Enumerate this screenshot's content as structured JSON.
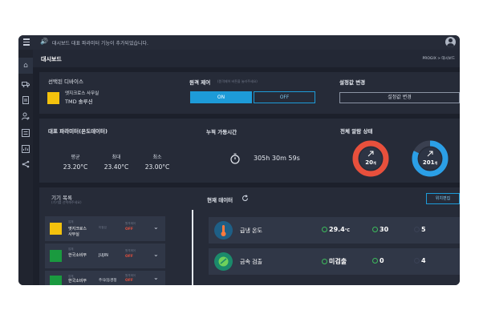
{
  "topbar": {
    "notice": "대시보드 대표 파라미터 기능이 추가되었습니다.",
    "speaker_icon": "speaker-icon",
    "user_icon": "user-icon"
  },
  "sidebar": {
    "items": [
      {
        "icon": "home-icon"
      },
      {
        "icon": "truck-icon"
      },
      {
        "icon": "document-icon"
      },
      {
        "icon": "user-settings-icon"
      },
      {
        "icon": "list-icon"
      },
      {
        "icon": "chart-icon"
      },
      {
        "icon": "share-icon"
      }
    ]
  },
  "header": {
    "title": "대시보드",
    "breadcrumb": "PROGIX > 대시보드"
  },
  "selected_device": {
    "label": "선택된 디바이스",
    "line1": "엣지크로스 사무실",
    "line2": "TMD 솔루션",
    "color": "#f4c20d"
  },
  "remote_control": {
    "label": "원격 제어",
    "hint": "(원격제어 버튼을 눌러주세요)",
    "on_label": "ON",
    "off_label": "OFF",
    "accent": "#1d9bd8"
  },
  "settings": {
    "label": "설정값 변경",
    "button": "설정값 변경"
  },
  "representative": {
    "title": "대표 파라미터(온도데이터)",
    "stats": [
      {
        "label": "평균",
        "value": "23.20°C"
      },
      {
        "label": "최대",
        "value": "23.40°C"
      },
      {
        "label": "최소",
        "value": "23.00°C"
      }
    ]
  },
  "runtime": {
    "title": "누적 가동시간",
    "value": "305h 30m 59s",
    "icon": "stopwatch-icon"
  },
  "alarm": {
    "title": "전체 알람 상태",
    "rings": [
      {
        "value": "20",
        "unit": "개",
        "color": "#e8503c",
        "fill": 1.0
      },
      {
        "value": "201",
        "unit": "개",
        "color": "#2b9fe6",
        "fill": 0.82
      }
    ]
  },
  "device_list": {
    "title": "기기 목록",
    "subtitle": "(기기를 선택해주세요)",
    "items": [
      {
        "tag": "업체",
        "name": "엣지크로스\n사무실",
        "status": "미점검",
        "off_label": "원격제어",
        "off": "OFF",
        "color": "#f4c20d"
      },
      {
        "tag": "업체",
        "name": "한국소비부",
        "status": "JUJIN",
        "off_label": "원격제어",
        "off": "OFF",
        "color": "#1a9a3f"
      },
      {
        "tag": "업체",
        "name": "한국소비부",
        "status": "주식(동경정",
        "off_label": "원격제어",
        "off": "OFF",
        "color": "#1a9a3f"
      }
    ]
  },
  "current_data": {
    "title": "현재 데이터",
    "edit_button": "위치편집",
    "rows": [
      {
        "name": "급냉 온도",
        "v1": "29.4",
        "v1_unit": "°C",
        "v2": "30",
        "v3": "5",
        "icon": "thermometer-icon",
        "icon_bg": "#1e5f86"
      },
      {
        "name": "금속 검출",
        "v1": "미검출",
        "v1_unit": "",
        "v2": "0",
        "v3": "4",
        "icon": "metal-detect-icon",
        "icon_bg": "#1b8a6b"
      }
    ]
  }
}
